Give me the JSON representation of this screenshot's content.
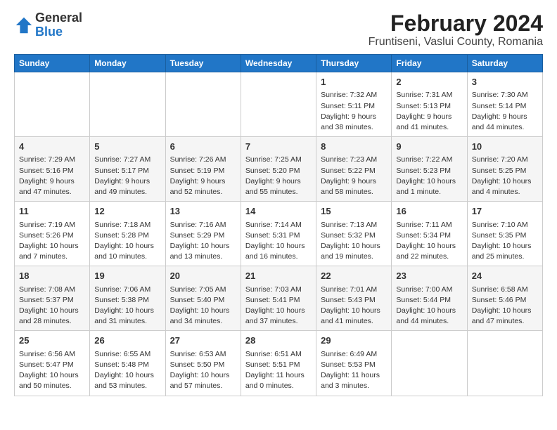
{
  "logo": {
    "general": "General",
    "blue": "Blue"
  },
  "header": {
    "month": "February 2024",
    "location": "Fruntiseni, Vaslui County, Romania"
  },
  "weekdays": [
    "Sunday",
    "Monday",
    "Tuesday",
    "Wednesday",
    "Thursday",
    "Friday",
    "Saturday"
  ],
  "weeks": [
    [
      {
        "day": "",
        "info": ""
      },
      {
        "day": "",
        "info": ""
      },
      {
        "day": "",
        "info": ""
      },
      {
        "day": "",
        "info": ""
      },
      {
        "day": "1",
        "info": "Sunrise: 7:32 AM\nSunset: 5:11 PM\nDaylight: 9 hours\nand 38 minutes."
      },
      {
        "day": "2",
        "info": "Sunrise: 7:31 AM\nSunset: 5:13 PM\nDaylight: 9 hours\nand 41 minutes."
      },
      {
        "day": "3",
        "info": "Sunrise: 7:30 AM\nSunset: 5:14 PM\nDaylight: 9 hours\nand 44 minutes."
      }
    ],
    [
      {
        "day": "4",
        "info": "Sunrise: 7:29 AM\nSunset: 5:16 PM\nDaylight: 9 hours\nand 47 minutes."
      },
      {
        "day": "5",
        "info": "Sunrise: 7:27 AM\nSunset: 5:17 PM\nDaylight: 9 hours\nand 49 minutes."
      },
      {
        "day": "6",
        "info": "Sunrise: 7:26 AM\nSunset: 5:19 PM\nDaylight: 9 hours\nand 52 minutes."
      },
      {
        "day": "7",
        "info": "Sunrise: 7:25 AM\nSunset: 5:20 PM\nDaylight: 9 hours\nand 55 minutes."
      },
      {
        "day": "8",
        "info": "Sunrise: 7:23 AM\nSunset: 5:22 PM\nDaylight: 9 hours\nand 58 minutes."
      },
      {
        "day": "9",
        "info": "Sunrise: 7:22 AM\nSunset: 5:23 PM\nDaylight: 10 hours\nand 1 minute."
      },
      {
        "day": "10",
        "info": "Sunrise: 7:20 AM\nSunset: 5:25 PM\nDaylight: 10 hours\nand 4 minutes."
      }
    ],
    [
      {
        "day": "11",
        "info": "Sunrise: 7:19 AM\nSunset: 5:26 PM\nDaylight: 10 hours\nand 7 minutes."
      },
      {
        "day": "12",
        "info": "Sunrise: 7:18 AM\nSunset: 5:28 PM\nDaylight: 10 hours\nand 10 minutes."
      },
      {
        "day": "13",
        "info": "Sunrise: 7:16 AM\nSunset: 5:29 PM\nDaylight: 10 hours\nand 13 minutes."
      },
      {
        "day": "14",
        "info": "Sunrise: 7:14 AM\nSunset: 5:31 PM\nDaylight: 10 hours\nand 16 minutes."
      },
      {
        "day": "15",
        "info": "Sunrise: 7:13 AM\nSunset: 5:32 PM\nDaylight: 10 hours\nand 19 minutes."
      },
      {
        "day": "16",
        "info": "Sunrise: 7:11 AM\nSunset: 5:34 PM\nDaylight: 10 hours\nand 22 minutes."
      },
      {
        "day": "17",
        "info": "Sunrise: 7:10 AM\nSunset: 5:35 PM\nDaylight: 10 hours\nand 25 minutes."
      }
    ],
    [
      {
        "day": "18",
        "info": "Sunrise: 7:08 AM\nSunset: 5:37 PM\nDaylight: 10 hours\nand 28 minutes."
      },
      {
        "day": "19",
        "info": "Sunrise: 7:06 AM\nSunset: 5:38 PM\nDaylight: 10 hours\nand 31 minutes."
      },
      {
        "day": "20",
        "info": "Sunrise: 7:05 AM\nSunset: 5:40 PM\nDaylight: 10 hours\nand 34 minutes."
      },
      {
        "day": "21",
        "info": "Sunrise: 7:03 AM\nSunset: 5:41 PM\nDaylight: 10 hours\nand 37 minutes."
      },
      {
        "day": "22",
        "info": "Sunrise: 7:01 AM\nSunset: 5:43 PM\nDaylight: 10 hours\nand 41 minutes."
      },
      {
        "day": "23",
        "info": "Sunrise: 7:00 AM\nSunset: 5:44 PM\nDaylight: 10 hours\nand 44 minutes."
      },
      {
        "day": "24",
        "info": "Sunrise: 6:58 AM\nSunset: 5:46 PM\nDaylight: 10 hours\nand 47 minutes."
      }
    ],
    [
      {
        "day": "25",
        "info": "Sunrise: 6:56 AM\nSunset: 5:47 PM\nDaylight: 10 hours\nand 50 minutes."
      },
      {
        "day": "26",
        "info": "Sunrise: 6:55 AM\nSunset: 5:48 PM\nDaylight: 10 hours\nand 53 minutes."
      },
      {
        "day": "27",
        "info": "Sunrise: 6:53 AM\nSunset: 5:50 PM\nDaylight: 10 hours\nand 57 minutes."
      },
      {
        "day": "28",
        "info": "Sunrise: 6:51 AM\nSunset: 5:51 PM\nDaylight: 11 hours\nand 0 minutes."
      },
      {
        "day": "29",
        "info": "Sunrise: 6:49 AM\nSunset: 5:53 PM\nDaylight: 11 hours\nand 3 minutes."
      },
      {
        "day": "",
        "info": ""
      },
      {
        "day": "",
        "info": ""
      }
    ]
  ]
}
